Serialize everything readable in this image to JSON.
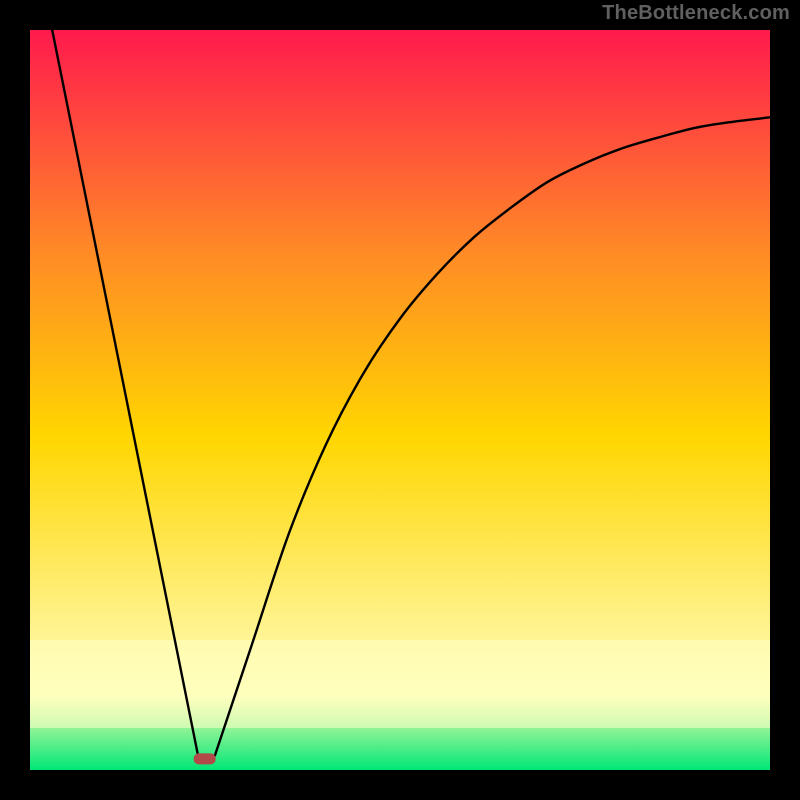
{
  "watermark": "TheBottleneck.com",
  "chart_data": {
    "type": "line",
    "title": "",
    "xlabel": "",
    "ylabel": "",
    "xlim": [
      0,
      1
    ],
    "ylim": [
      0,
      1
    ],
    "background_gradient": {
      "top": "#ff1a4d",
      "upper_mid": "#ff8a26",
      "mid": "#ffd600",
      "lower_mid": "#fff28a",
      "band": "#ffffb0",
      "bottom": "#00e676"
    },
    "series": [
      {
        "name": "left-branch",
        "x": [
          0.03,
          0.228
        ],
        "y": [
          1.0,
          0.015
        ],
        "note": "steep near-linear descent from top-left toward minimum"
      },
      {
        "name": "right-branch",
        "x": [
          0.25,
          0.3,
          0.35,
          0.4,
          0.45,
          0.5,
          0.55,
          0.6,
          0.65,
          0.7,
          0.75,
          0.8,
          0.85,
          0.9,
          0.95,
          1.0
        ],
        "y": [
          0.02,
          0.17,
          0.32,
          0.44,
          0.535,
          0.61,
          0.67,
          0.72,
          0.76,
          0.795,
          0.82,
          0.84,
          0.855,
          0.868,
          0.876,
          0.882
        ],
        "note": "concave-up rise saturating toward ~0.88 at right edge"
      }
    ],
    "marker": {
      "name": "minimum-point",
      "x": 0.236,
      "y": 0.015,
      "color": "#b34a4a",
      "shape": "rounded-rect"
    }
  }
}
